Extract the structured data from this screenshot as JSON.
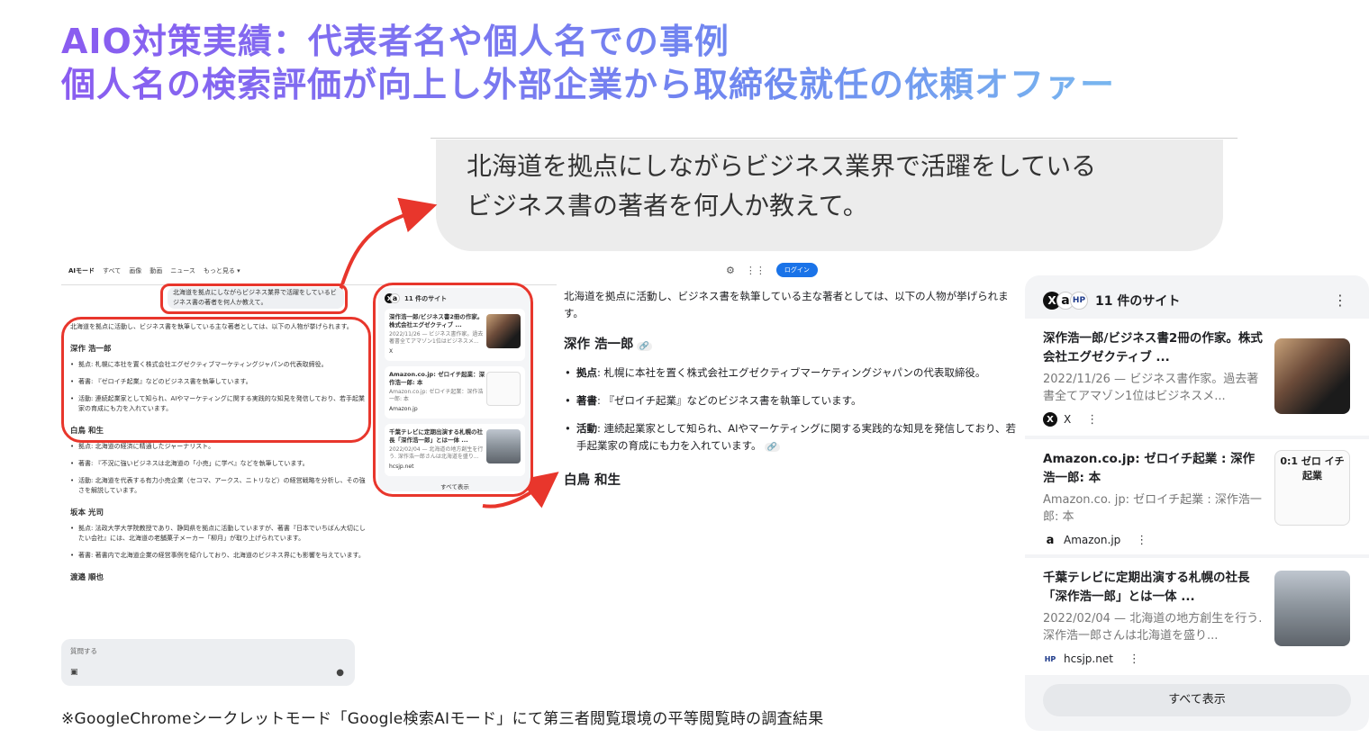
{
  "headline": {
    "line1": "AIO対策実績：代表者名や個人名での事例",
    "line2": "個人名の検索評価が向上し外部企業から取締役就任の依頼オファー"
  },
  "query_bubble": {
    "line1": "北海道を拠点にしながらビジネス業界で活躍をしている",
    "line2": "ビジネス書の著者を何人か教えて。"
  },
  "mini_screen": {
    "tabs": [
      "AIモード",
      "すべて",
      "画像",
      "動画",
      "ニュース",
      "もっと見る ▾"
    ],
    "query": "北海道を拠点にしながらビジネス業界で活躍をしているビジネス書の著者を何人か教えて。",
    "intro": "北海道を拠点に活動し、ビジネス書を執筆している主な著者としては、以下の人物が挙げられます。",
    "people": [
      {
        "name": "深作 浩一郎",
        "items": [
          "拠点: 札幌に本社を置く株式会社エグゼクティブマーケティングジャパンの代表取締役。",
          "著書: 『ゼロイチ起業』などのビジネス書を執筆しています。",
          "活動: 連続起業家として知られ、AIやマーケティングに関する実践的な知見を発信しており、若手起業家の育成にも力を入れています。"
        ]
      },
      {
        "name": "白鳥 和生",
        "items": [
          "拠点: 北海道の経済に精通したジャーナリスト。",
          "著書: 『不況に強いビジネスは北海道の「小売」に学べ』などを執筆しています。",
          "活動: 北海道を代表する有力小売企業（セコマ、アークス、ニトリなど）の経営戦略を分析し、その強さを解説しています。"
        ]
      },
      {
        "name": "坂本 光司",
        "items": [
          "拠点: 法政大学大学院教授であり、静岡県を拠点に活動していますが、著書『日本でいちばん大切にしたい会社』には、北海道の老舗菓子メーカー「柳月」が取り上げられています。",
          "著書: 著書内で北海道企業の経営事例を紹介しており、北海道のビジネス界にも影響を与えています。"
        ]
      },
      {
        "name": "渡邉 順也",
        "items": []
      }
    ],
    "sources_title": "11 件のサイト",
    "source_cards": [
      {
        "title": "深作浩一郎/ビジネス書2冊の作家。株式会社エグゼクティブ ...",
        "desc": "2022/11/26 — ビジネス書作家。過去著書全てアマゾン1位はビジネスメ...",
        "site": "X"
      },
      {
        "title": "Amazon.co.jp: ゼロイチ起業：深作浩一郎: 本",
        "desc": "Amazon.co.jp: ゼロイチ起業：深作浩一郎: 本",
        "site": "Amazon.jp"
      },
      {
        "title": "千葉テレビに定期出演する札幌の社長「深作浩一郎」とは一体 ...",
        "desc": "2022/02/04 — 北海道の地方創生を行う. 深作浩一郎さんは北海道を盛り...",
        "site": "hcsjp.net"
      }
    ],
    "show_all": "すべて表示",
    "ask_placeholder": "質問する"
  },
  "mid_answer": {
    "login_label": "ログイン",
    "intro": "北海道を拠点に活動し、ビジネス書を執筆している主な著者としては、以下の人物が挙げられます。",
    "person_name": "深作 浩一郎",
    "items": [
      {
        "label": "拠点",
        "text": ": 札幌に本社を置く株式会社エグゼクティブマーケティングジャパンの代表取締役。"
      },
      {
        "label": "著書",
        "text": ": 『ゼロイチ起業』などのビジネス書を執筆しています。"
      },
      {
        "label": "活動",
        "text": ": 連続起業家として知られ、AIやマーケティングに関する実践的な知見を発信しており、若手起業家の育成にも力を入れています。"
      }
    ],
    "next_name": "白鳥 和生"
  },
  "panel": {
    "title": "11 件のサイト",
    "cards": [
      {
        "title": "深作浩一郎/ビジネス書2冊の作家。株式会社エグゼクティブ ...",
        "desc": "2022/11/26 — ビジネス書作家。過去著書全てアマゾン1位はビジネスメ...",
        "site": "X"
      },
      {
        "title": "Amazon.co.jp: ゼロイチ起業 : 深作浩一郎: 本",
        "desc": "Amazon.co. jp: ゼロイチ起業 : 深作浩一郎: 本",
        "site": "Amazon.jp",
        "book_text": "0:1 ゼロ イチ 起業"
      },
      {
        "title": "千葉テレビに定期出演する札幌の社長「深作浩一郎」とは一体 ...",
        "desc": "2022/02/04 — 北海道の地方創生を行う. 深作浩一郎さんは北海道を盛り...",
        "site": "hcsjp.net"
      }
    ],
    "show_all": "すべて表示"
  },
  "footnote": "※GoogleChromeシークレットモード「Google検索AIモード」にて第三者閲覧環境の平等閲覧時の調査結果",
  "colors": {
    "highlight_red": "#e8362c",
    "google_blue": "#1a73e8",
    "gradient_start": "#8a5cf0",
    "gradient_end": "#7fd3ee"
  }
}
